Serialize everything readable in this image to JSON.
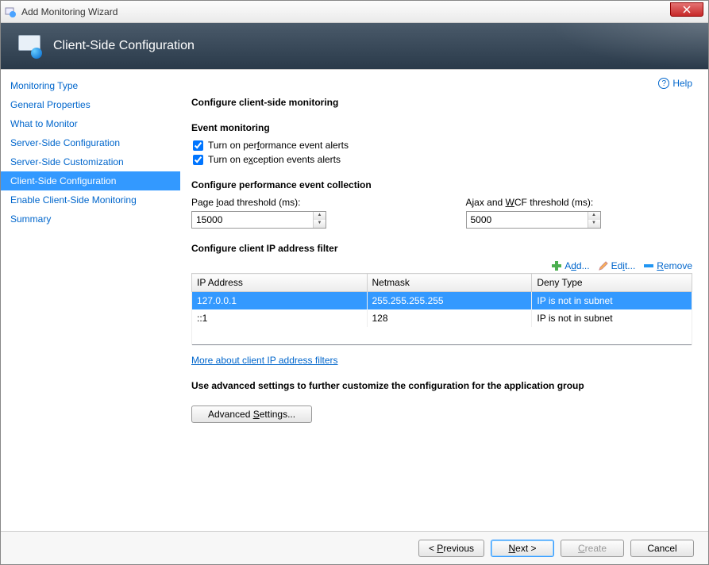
{
  "window": {
    "title": "Add Monitoring Wizard"
  },
  "banner": {
    "title": "Client-Side Configuration"
  },
  "help": {
    "label": "Help"
  },
  "nav": {
    "items": [
      {
        "label": "Monitoring Type"
      },
      {
        "label": "General Properties"
      },
      {
        "label": "What to Monitor"
      },
      {
        "label": "Server-Side Configuration"
      },
      {
        "label": "Server-Side Customization"
      },
      {
        "label": "Client-Side Configuration",
        "active": true
      },
      {
        "label": "Enable Client-Side Monitoring"
      },
      {
        "label": "Summary"
      }
    ]
  },
  "sections": {
    "main_heading": "Configure client-side monitoring",
    "event_heading": "Event monitoring",
    "perf_heading": "Configure performance event collection",
    "ip_heading": "Configure client IP address filter",
    "adv_heading": "Use advanced settings to further customize the configuration for the application group"
  },
  "checkboxes": {
    "perf_alerts_pre": "Turn on per",
    "perf_alerts_key": "f",
    "perf_alerts_post": "ormance event alerts",
    "perf_alerts_checked": true,
    "exc_alerts_pre": "Turn on e",
    "exc_alerts_key": "x",
    "exc_alerts_post": "ception events alerts",
    "exc_alerts_checked": true
  },
  "thresholds": {
    "page_pre": "Page ",
    "page_key": "l",
    "page_post": "oad threshold (ms):",
    "page_value": "15000",
    "ajax_pre": "Ajax and ",
    "ajax_key": "W",
    "ajax_post": "CF threshold (ms):",
    "ajax_value": "5000"
  },
  "toolbar": {
    "add_pre": "A",
    "add_key": "d",
    "add_post": "d...",
    "edit_pre": "Ed",
    "edit_key": "i",
    "edit_post": "t...",
    "remove_pre": "",
    "remove_key": "R",
    "remove_post": "emove"
  },
  "table": {
    "headers": {
      "ip": "IP Address",
      "netmask": "Netmask",
      "deny": "Deny Type"
    },
    "rows": [
      {
        "ip": "127.0.0.1",
        "netmask": "255.255.255.255",
        "deny": "IP is not in subnet",
        "selected": true
      },
      {
        "ip": "::1",
        "netmask": "128",
        "deny": "IP is not in subnet",
        "selected": false
      }
    ]
  },
  "links": {
    "more_filters": "More about client IP address filters"
  },
  "buttons": {
    "advanced_pre": "Advanced ",
    "advanced_key": "S",
    "advanced_post": "ettings...",
    "previous_pre": "< ",
    "previous_key": "P",
    "previous_post": "revious",
    "next_pre": "",
    "next_key": "N",
    "next_post": "ext >",
    "create_pre": "",
    "create_key": "C",
    "create_post": "reate",
    "cancel": "Cancel"
  }
}
